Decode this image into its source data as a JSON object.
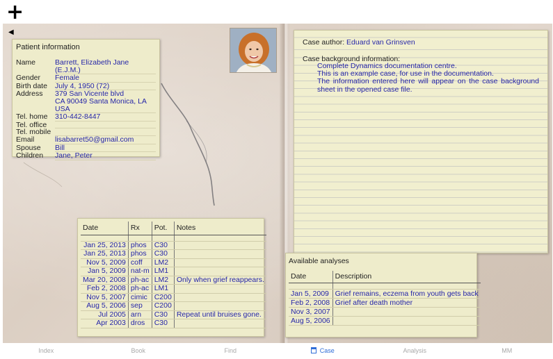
{
  "toolbar": {
    "add_icon": "plus-icon"
  },
  "sidebar_toggle_icon": "triangle-left-icon",
  "patient": {
    "title": "Patient information",
    "fields": [
      {
        "label": "Name",
        "value": [
          "Barrett, Elizabeth Jane (E.J.M.)"
        ]
      },
      {
        "label": "Gender",
        "value": [
          "Female"
        ]
      },
      {
        "label": "Birth date",
        "value": [
          "July 4, 1950 (72)"
        ]
      },
      {
        "label": "Address",
        "value": [
          "379 San Vicente blvd",
          "CA 90049  Santa Monica, LA",
          "USA"
        ]
      },
      {
        "label": "Tel. home",
        "value": [
          "310-442-8447"
        ]
      },
      {
        "label": "Tel. office",
        "value": [
          ""
        ]
      },
      {
        "label": "Tel. mobile",
        "value": [
          ""
        ]
      },
      {
        "label": "Email",
        "value": [
          "lisabarret50@gmail.com"
        ]
      },
      {
        "label": "Spouse",
        "value": [
          "Bill"
        ]
      },
      {
        "label": "Children",
        "value": [
          "Jane, Peter"
        ]
      }
    ]
  },
  "case": {
    "author_label": "Case author:",
    "author_value": "Eduard van Grinsven",
    "background_label": "Case background information:",
    "background_lines": [
      "Complete Dynamics documentation centre.",
      "This is an example case, for use in the documentation.",
      "The information entered here will appear on the case background sheet in the opened case file."
    ]
  },
  "prescriptions": {
    "headers": [
      "Date",
      "Rx",
      "Pot.",
      "Notes"
    ],
    "rows": [
      [
        "Jan 25, 2013",
        "phos",
        "C30",
        ""
      ],
      [
        "Jan 25, 2013",
        "phos",
        "C30",
        ""
      ],
      [
        "Nov 5, 2009",
        "coff",
        "LM2",
        ""
      ],
      [
        "Jan 5, 2009",
        "nat-m",
        "LM1",
        ""
      ],
      [
        "Mar 20, 2008",
        "ph-ac",
        "LM2",
        "Only when grief reappears."
      ],
      [
        "Feb 2, 2008",
        "ph-ac",
        "LM1",
        ""
      ],
      [
        "Nov 5, 2007",
        "cimic",
        "C200",
        ""
      ],
      [
        "Aug 5, 2006",
        "sep",
        "C200",
        ""
      ],
      [
        "Jul 2005",
        "arn",
        "C30",
        "Repeat until bruises gone."
      ],
      [
        "Apr 2003",
        "dros",
        "C30",
        ""
      ]
    ]
  },
  "analyses": {
    "title": "Available analyses",
    "headers": [
      "Date",
      "Description"
    ],
    "rows": [
      [
        "Jan 5, 2009",
        "Grief remains, eczema from youth gets back"
      ],
      [
        "Feb 2, 2008",
        "Grief after death mother"
      ],
      [
        "Nov 3, 2007",
        ""
      ],
      [
        "Aug 5, 2006",
        ""
      ]
    ]
  },
  "tabs": [
    {
      "label": "Index",
      "active": false
    },
    {
      "label": "Book",
      "active": false
    },
    {
      "label": "Find",
      "active": false
    },
    {
      "label": "Case",
      "active": true,
      "icon": "case-icon"
    },
    {
      "label": "Analysis",
      "active": false
    },
    {
      "label": "MM",
      "active": false
    }
  ],
  "colors": {
    "value_text": "#2626a8",
    "panel": "#eeeccb",
    "active_tab": "#2f6ed8"
  }
}
